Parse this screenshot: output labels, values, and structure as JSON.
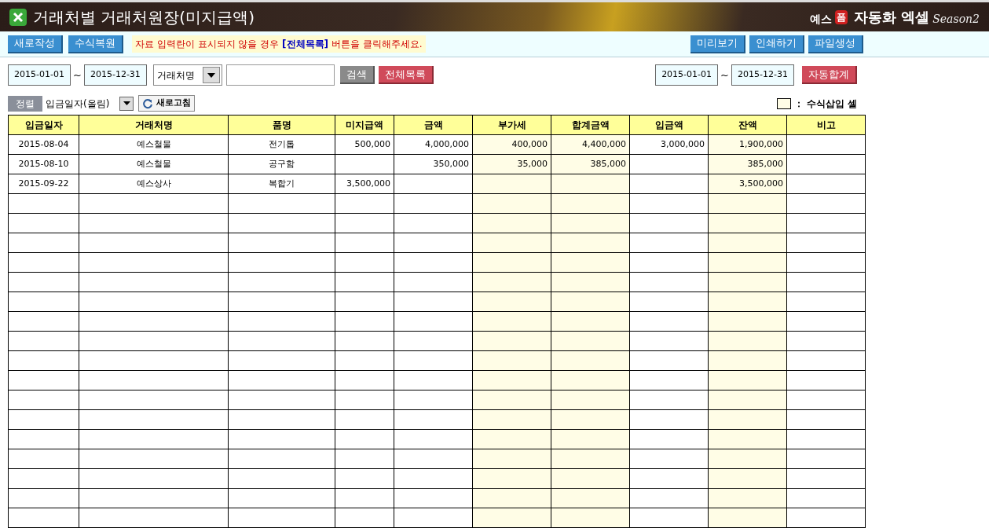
{
  "header": {
    "title": "거래처별 거래처원장(미지급액)",
    "brand": {
      "prefix": "예스",
      "badge": "폼",
      "name": "자동화 엑셀",
      "season": "Season2"
    }
  },
  "toolbar": {
    "left_buttons": [
      "새로작성",
      "수식복원"
    ],
    "notice": "자료 입력란이 표시되지  않을 경우 **[전체목록]** 버튼을 클릭해주세요.",
    "right_buttons": [
      "미리보기",
      "인쇄하기",
      "파일생성"
    ]
  },
  "filter": {
    "date_from": "2015-01-01",
    "tilde": "~",
    "date_to": "2015-12-31",
    "field_select": "거래처명",
    "search_button": "검색",
    "all_button": "전체목록"
  },
  "sum_filter": {
    "date_from": "2015-01-01",
    "tilde": "~",
    "date_to": "2015-12-31",
    "button": "자동합계"
  },
  "sort": {
    "label": "정렬",
    "value": "입금일자(올림)",
    "refresh_button": "새로고침"
  },
  "legend": {
    "text": "： 수식삽입 셀"
  },
  "table": {
    "columns": [
      {
        "label": "입금일자",
        "formula": false,
        "kind": "text"
      },
      {
        "label": "거래처명",
        "formula": false,
        "kind": "text"
      },
      {
        "label": "품명",
        "formula": false,
        "kind": "text"
      },
      {
        "label": "미지급액",
        "formula": false,
        "kind": "amount"
      },
      {
        "label": "금액",
        "formula": false,
        "kind": "amount"
      },
      {
        "label": "부가세",
        "formula": true,
        "kind": "amount"
      },
      {
        "label": "합계금액",
        "formula": true,
        "kind": "amount"
      },
      {
        "label": "입금액",
        "formula": false,
        "kind": "amount"
      },
      {
        "label": "잔액",
        "formula": true,
        "kind": "amount"
      },
      {
        "label": "비고",
        "formula": false,
        "kind": "text"
      }
    ],
    "rows": [
      [
        "2015-08-04",
        "예스철물",
        "전기톱",
        "500,000",
        "4,000,000",
        "400,000",
        "4,400,000",
        "3,000,000",
        "1,900,000",
        null
      ],
      [
        "2015-08-10",
        "예스철물",
        "공구함",
        null,
        "350,000",
        "35,000",
        "385,000",
        null,
        "385,000",
        null
      ],
      [
        "2015-09-22",
        "예스상사",
        "복합기",
        "3,500,000",
        null,
        null,
        null,
        null,
        "3,500,000",
        null
      ]
    ]
  }
}
